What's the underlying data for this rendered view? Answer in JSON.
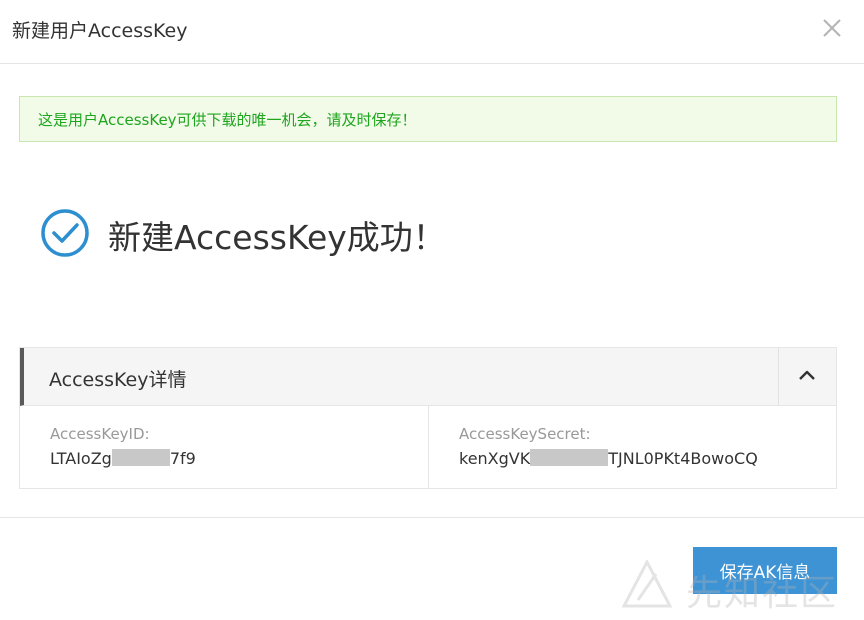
{
  "dialog": {
    "title": "新建用户AccessKey",
    "close_icon": "close-icon"
  },
  "alert": {
    "message": "这是用户AccessKey可供下载的唯一机会，请及时保存！"
  },
  "result": {
    "icon": "check-circle-icon",
    "message": "新建AccessKey成功！"
  },
  "details": {
    "title": "AccessKey详情",
    "toggle_icon": "chevron-up-icon",
    "access_key_id": {
      "label": "AccessKeyID:",
      "value_prefix": "LTAIoZg",
      "value_suffix": "7f9"
    },
    "access_key_secret": {
      "label": "AccessKeySecret:",
      "value_prefix": "kenXgVK",
      "value_suffix": "TJNL0PKt4BowoCQ"
    }
  },
  "footer": {
    "save_label": "保存AK信息"
  },
  "watermark": {
    "text": "先知社区"
  },
  "colors": {
    "primary_button": "#3d93d4",
    "success_icon": "#2d8fd0",
    "alert_text": "#1ea51e",
    "alert_bg": "#f1fbe8"
  }
}
